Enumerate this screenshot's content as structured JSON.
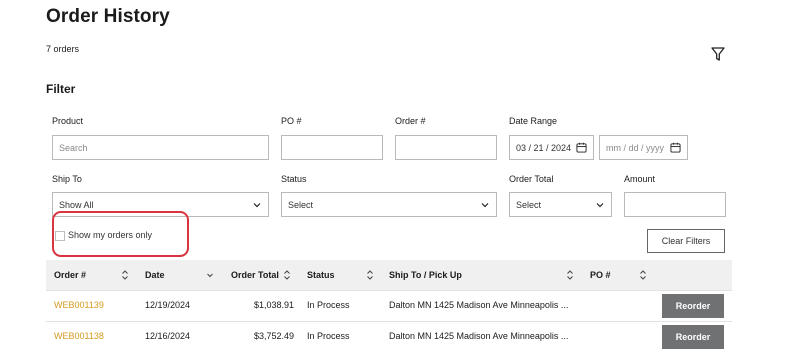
{
  "page": {
    "title": "Order History",
    "order_count": "7 orders",
    "filter_heading": "Filter"
  },
  "filters": {
    "product": {
      "label": "Product",
      "placeholder": "Search"
    },
    "po": {
      "label": "PO #",
      "value": ""
    },
    "order": {
      "label": "Order #",
      "value": ""
    },
    "date_range": {
      "label": "Date Range",
      "start": "03 / 21 / 2024",
      "end_placeholder": "mm / dd / yyyy"
    },
    "ship_to": {
      "label": "Ship To",
      "value": "Show All"
    },
    "status": {
      "label": "Status",
      "value": "Select"
    },
    "order_total": {
      "label": "Order Total",
      "value": "Select"
    },
    "amount": {
      "label": "Amount",
      "value": ""
    },
    "my_orders_label": "Show my orders only",
    "clear_label": "Clear Filters"
  },
  "table": {
    "headers": {
      "order": "Order #",
      "date": "Date",
      "total": "Order Total",
      "status": "Status",
      "ship_to": "Ship To / Pick Up",
      "po": "PO #"
    },
    "rows": [
      {
        "order": "WEB001139",
        "date": "12/19/2024",
        "total": "$1,038.91",
        "status": "In Process",
        "ship_to": "Dalton MN 1425 Madison Ave Minneapolis ...",
        "po": "",
        "action": "Reorder"
      },
      {
        "order": "WEB001138",
        "date": "12/16/2024",
        "total": "$3,752.49",
        "status": "In Process",
        "ship_to": "Dalton MN 1425 Madison Ave Minneapolis ...",
        "po": "",
        "action": "Reorder"
      }
    ]
  },
  "colors": {
    "link": "#d49a21",
    "highlight": "#d9333f",
    "button": "#6f7173",
    "header_bg": "#f0f0f0"
  },
  "icons": [
    "filter-icon",
    "calendar-icon",
    "chevron-down-icon",
    "sort-icon"
  ]
}
